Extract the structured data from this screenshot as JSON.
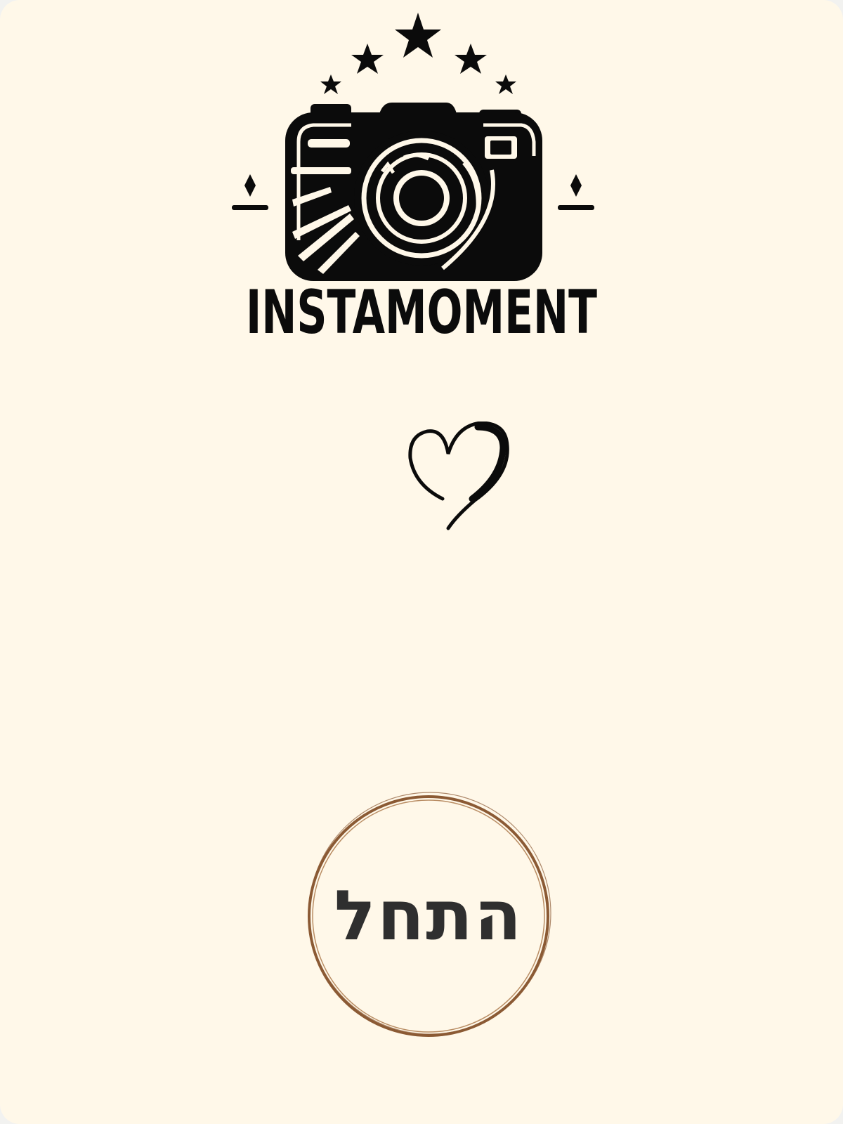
{
  "app": {
    "logo_text": "INSTAMOMENT",
    "logo_icon": "camera-with-stars-icon"
  },
  "decoration": {
    "icon": "heart-icon"
  },
  "start_button": {
    "label": "התחל"
  },
  "colors": {
    "background": "#fff8e9",
    "ring": "#8b5a34",
    "ink": "#0b0b0b",
    "label": "#2f2f2f"
  }
}
